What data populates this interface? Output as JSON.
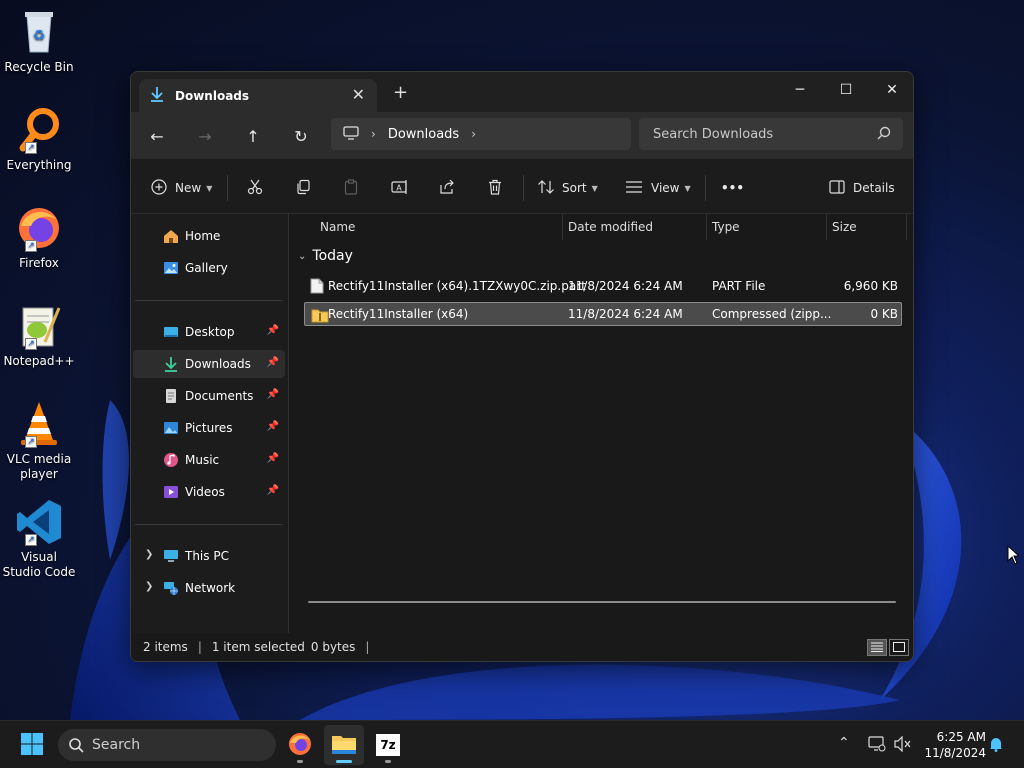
{
  "desktop": {
    "icons": [
      {
        "label": "Recycle Bin"
      },
      {
        "label": "Everything"
      },
      {
        "label": "Firefox"
      },
      {
        "label": "Notepad++"
      },
      {
        "label": "VLC media player"
      },
      {
        "label": "Visual Studio Code"
      }
    ]
  },
  "window": {
    "tab_title": "Downloads",
    "new_tab_glyph": "+",
    "controls": {
      "minimize": "─",
      "maximize": "☐",
      "close": "✕"
    },
    "nav": {
      "back": "←",
      "forward": "→",
      "up": "↑",
      "refresh": "↻"
    },
    "breadcrumb": [
      "Downloads"
    ],
    "search_placeholder": "Search Downloads",
    "commands": {
      "new": "New",
      "sort": "Sort",
      "view": "View",
      "more": "•••",
      "details": "Details"
    },
    "sidebar": {
      "items": [
        {
          "label": "Home",
          "icon": "home-icon",
          "pinned": false
        },
        {
          "label": "Gallery",
          "icon": "gallery-icon",
          "pinned": false
        },
        {
          "label": "Desktop",
          "icon": "desktop-icon",
          "pinned": true
        },
        {
          "label": "Downloads",
          "icon": "download-icon",
          "pinned": true,
          "selected": true
        },
        {
          "label": "Documents",
          "icon": "document-icon",
          "pinned": true
        },
        {
          "label": "Pictures",
          "icon": "pictures-icon",
          "pinned": true
        },
        {
          "label": "Music",
          "icon": "music-icon",
          "pinned": true
        },
        {
          "label": "Videos",
          "icon": "videos-icon",
          "pinned": true
        },
        {
          "label": "This PC",
          "icon": "computer-icon",
          "expandable": true
        },
        {
          "label": "Network",
          "icon": "network-icon",
          "expandable": true
        }
      ]
    },
    "columns": {
      "name": "Name",
      "date": "Date modified",
      "type": "Type",
      "size": "Size"
    },
    "group_label": "Today",
    "files": [
      {
        "name": "Rectify11Installer (x64).1TZXwy0C.zip.part",
        "date": "11/8/2024 6:24 AM",
        "type": "PART File",
        "size": "6,960 KB",
        "icon": "file-icon"
      },
      {
        "name": "Rectify11Installer (x64)",
        "date": "11/8/2024 6:24 AM",
        "type": "Compressed (zipp...",
        "size": "0 KB",
        "icon": "zip-folder-icon",
        "selected": true
      }
    ],
    "status": {
      "items": "2 items",
      "selection": "1 item selected",
      "size": "0 bytes"
    }
  },
  "taskbar": {
    "search_placeholder": "Search",
    "clock_time": "6:25 AM",
    "clock_date": "11/8/2024",
    "apps": [
      {
        "name": "firefox-icon"
      },
      {
        "name": "file-explorer-icon",
        "active": true
      },
      {
        "name": "7zip-icon",
        "label": "7z"
      }
    ]
  },
  "colors": {
    "accent": "#60cdff",
    "selection": "#4b4b4b",
    "window_bg": "#191919"
  }
}
